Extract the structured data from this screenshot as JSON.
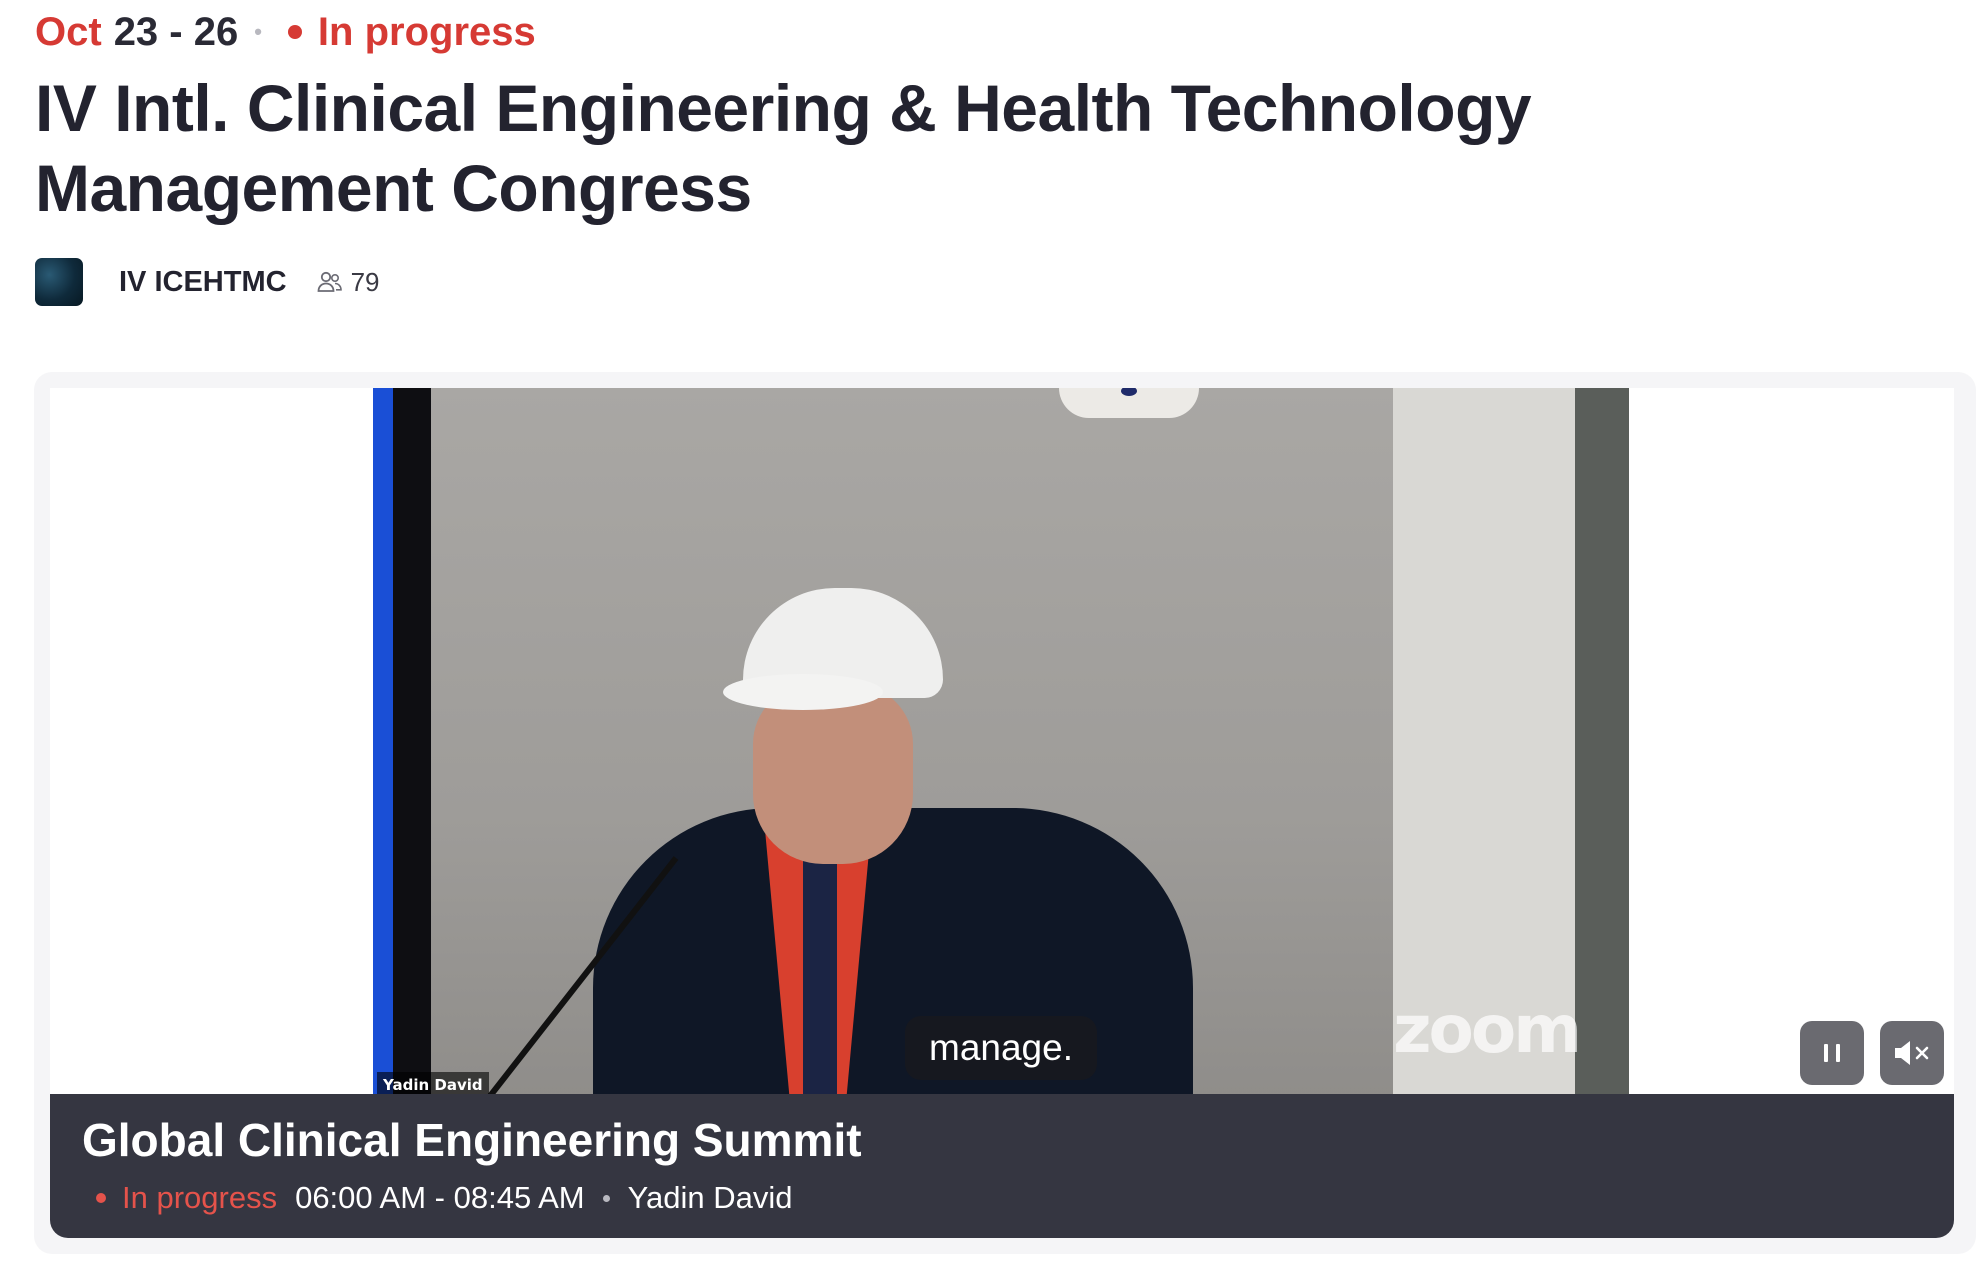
{
  "event": {
    "date_month": "Oct",
    "date_range": "23 - 26",
    "status": "In progress",
    "title": "IV Intl. Clinical Engineering & Health Technology Management Congress"
  },
  "organizer": {
    "name": "IV ICEHTMC",
    "member_count": "79",
    "members_icon": "people-icon"
  },
  "video": {
    "participant_name": "Yadin David",
    "watermark": "zoom",
    "caption": "manage.",
    "controls": {
      "pause_icon": "pause-icon",
      "mute_icon": "muted-speaker-icon"
    }
  },
  "session": {
    "title": "Global Clinical Engineering Summit",
    "status": "In progress",
    "time": "06:00 AM - 08:45 AM",
    "speaker": "Yadin David"
  },
  "colors": {
    "accent_red": "#d63a34",
    "info_bar_bg": "#353641",
    "control_bg": "#6a6a70"
  }
}
